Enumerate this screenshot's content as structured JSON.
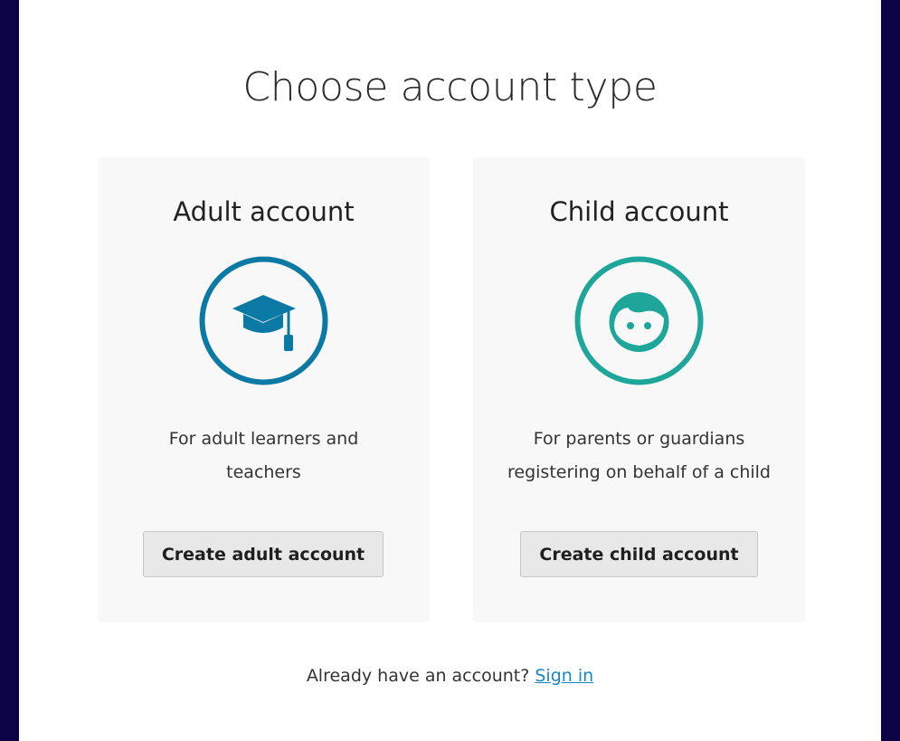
{
  "page": {
    "title": "Choose account type"
  },
  "cards": {
    "adult": {
      "title": "Adult account",
      "icon": "graduation-cap-icon",
      "icon_color": "#0a79a3",
      "description_line1": "For adult learners and",
      "description_line2": "teachers",
      "button_label": "Create adult account"
    },
    "child": {
      "title": "Child account",
      "icon": "child-face-icon",
      "icon_color": "#1fa69b",
      "description_line1": "For parents or guardians",
      "description_line2": "registering on behalf of a child",
      "button_label": "Create child account"
    }
  },
  "footer": {
    "prompt": "Already have an account?",
    "signin_label": "Sign in",
    "link_color": "#1a86c8"
  }
}
